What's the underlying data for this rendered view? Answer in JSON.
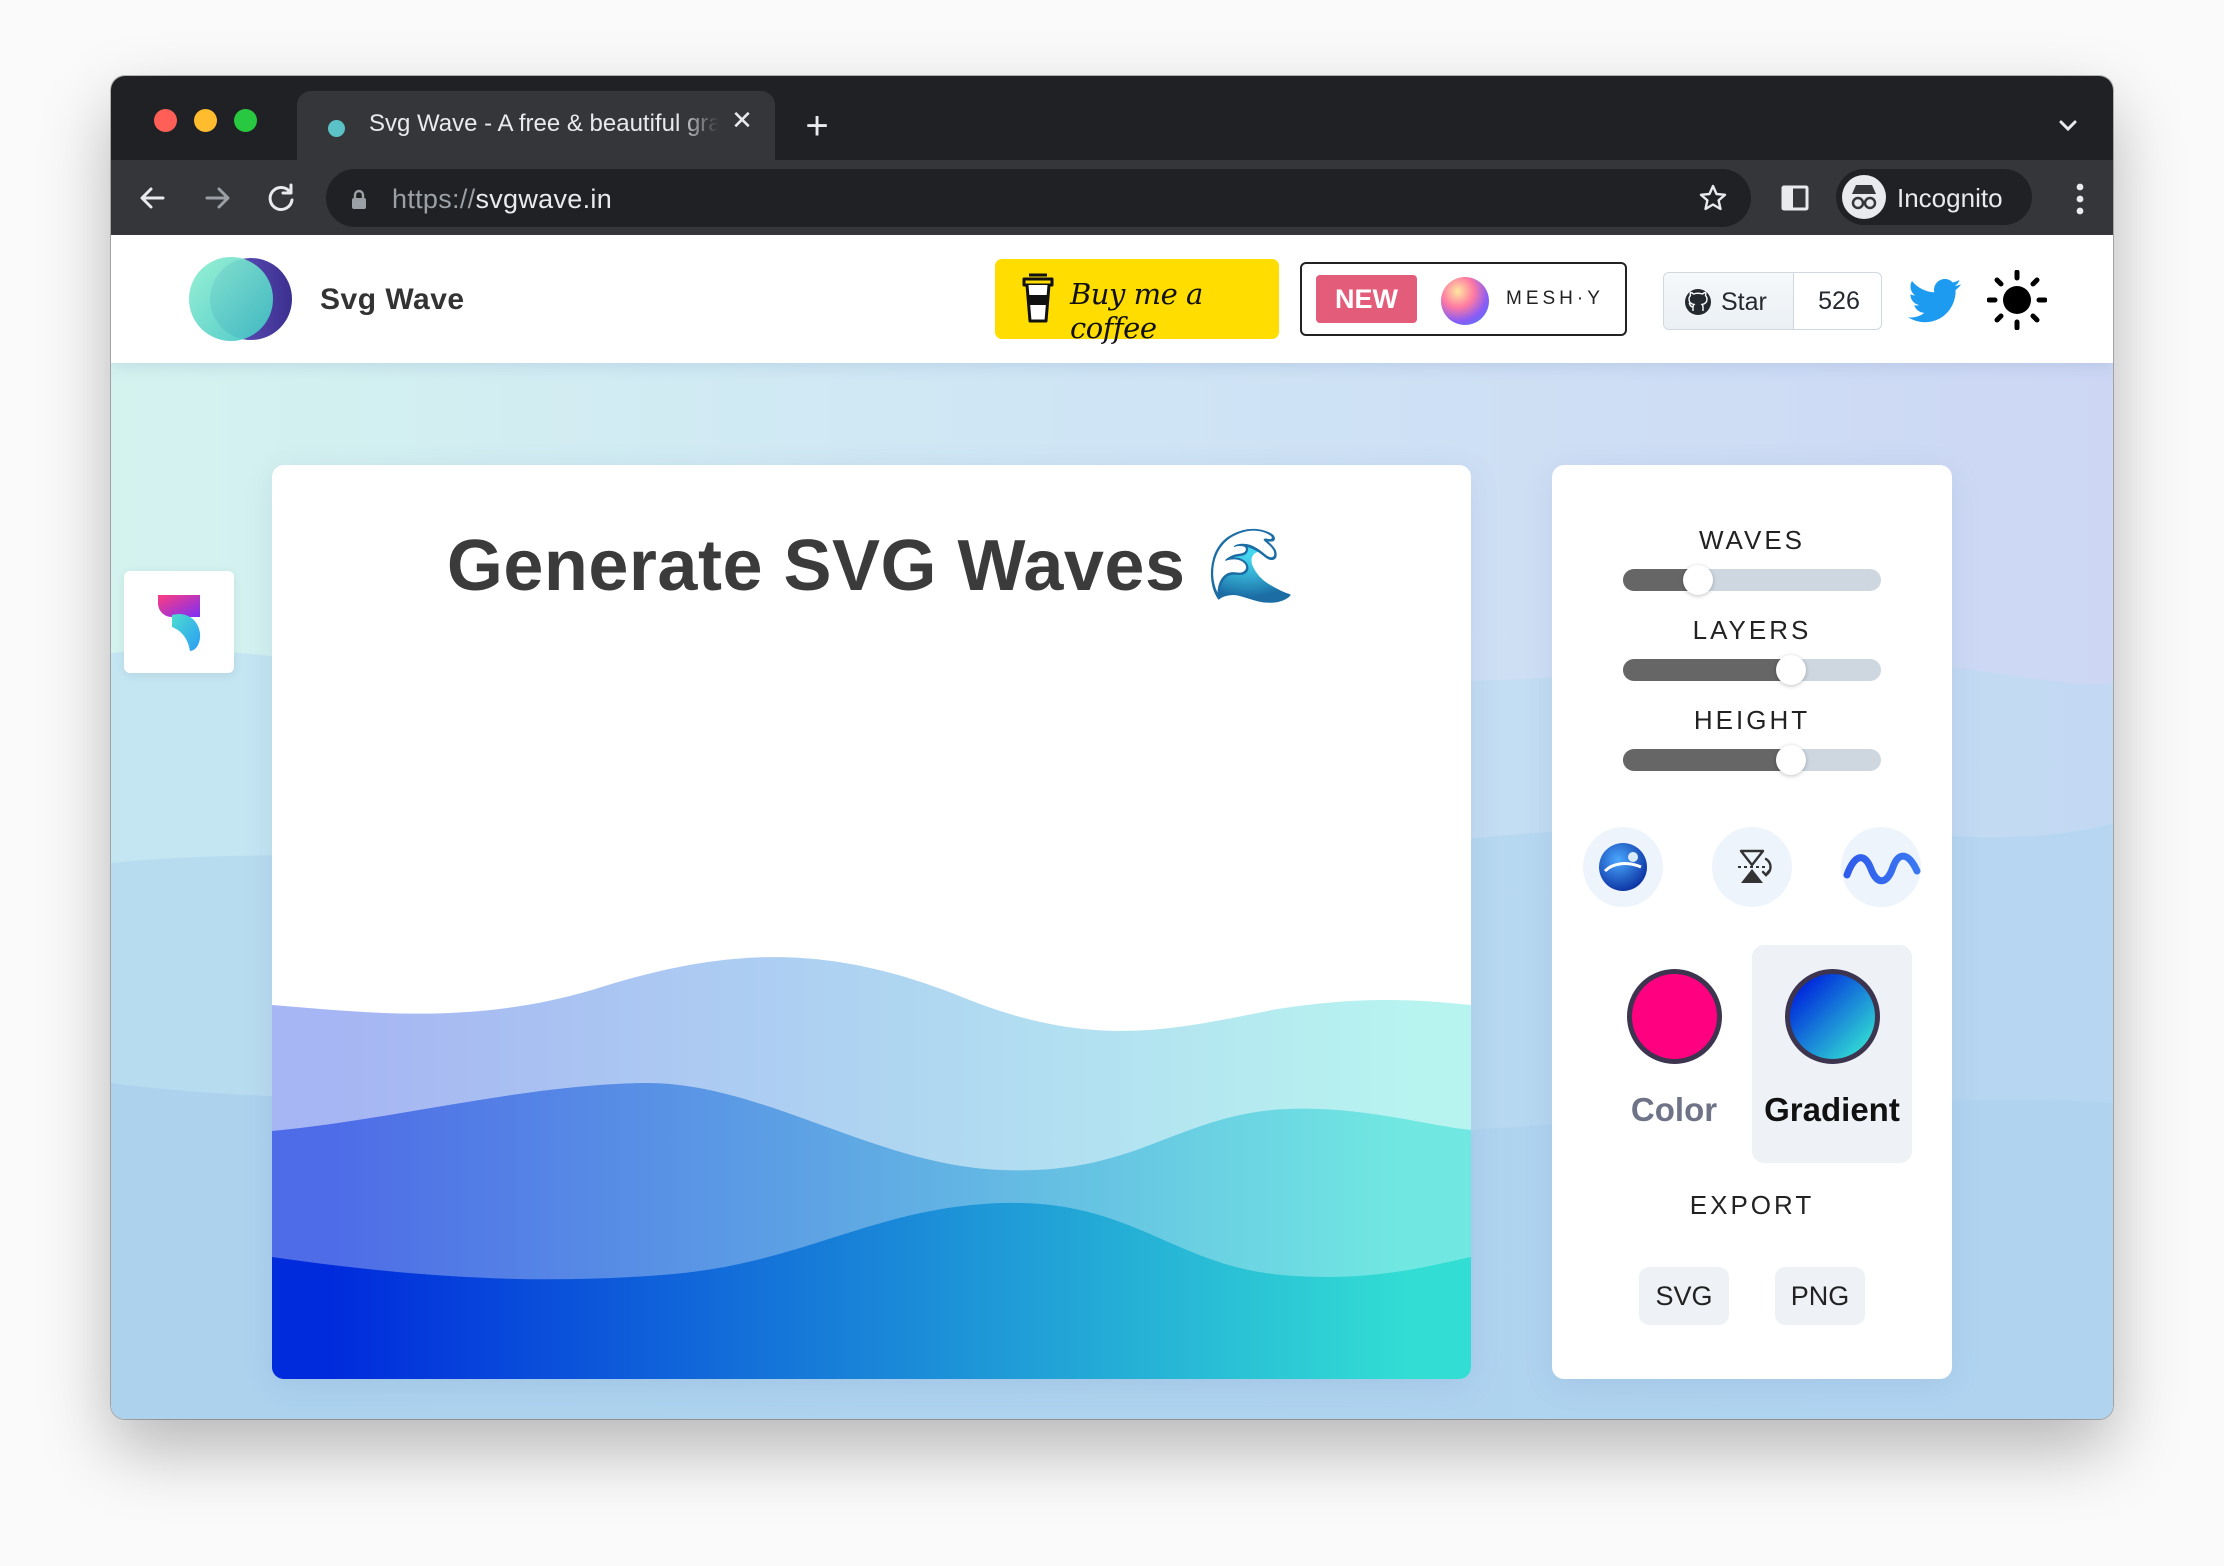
{
  "browser": {
    "tab_title": "Svg Wave - A free & beautiful gradient SVG wave Generator.",
    "tab_close": "✕",
    "new_tab": "+",
    "url_scheme": "https://",
    "url_host": "svgwave.in",
    "profile_label": "Incognito"
  },
  "header": {
    "brand": "Svg Wave",
    "coffee_label": "Buy me a coffee",
    "new_badge": "NEW",
    "meshy_label": "MESH·Y",
    "github_star_label": "Star",
    "github_star_count": "526"
  },
  "main": {
    "title": "Generate SVG Waves 🌊"
  },
  "panel": {
    "waves_label": "WAVES",
    "layers_label": "LAYERS",
    "height_label": "HEIGHT",
    "waves_value": 0.29,
    "layers_value": 0.65,
    "height_value": 0.65,
    "color_label": "Color",
    "gradient_label": "Gradient",
    "export_label": "EXPORT",
    "svg_button": "SVG",
    "png_button": "PNG",
    "selected_mode": "Gradient",
    "solid_color": "#ff0080",
    "gradient_colors": [
      "#002bdc",
      "#32ded4"
    ]
  },
  "colors": {
    "coffee_yellow": "#ffdd00",
    "new_badge": "#e35c7a",
    "twitter_blue": "#1d9bf0"
  }
}
